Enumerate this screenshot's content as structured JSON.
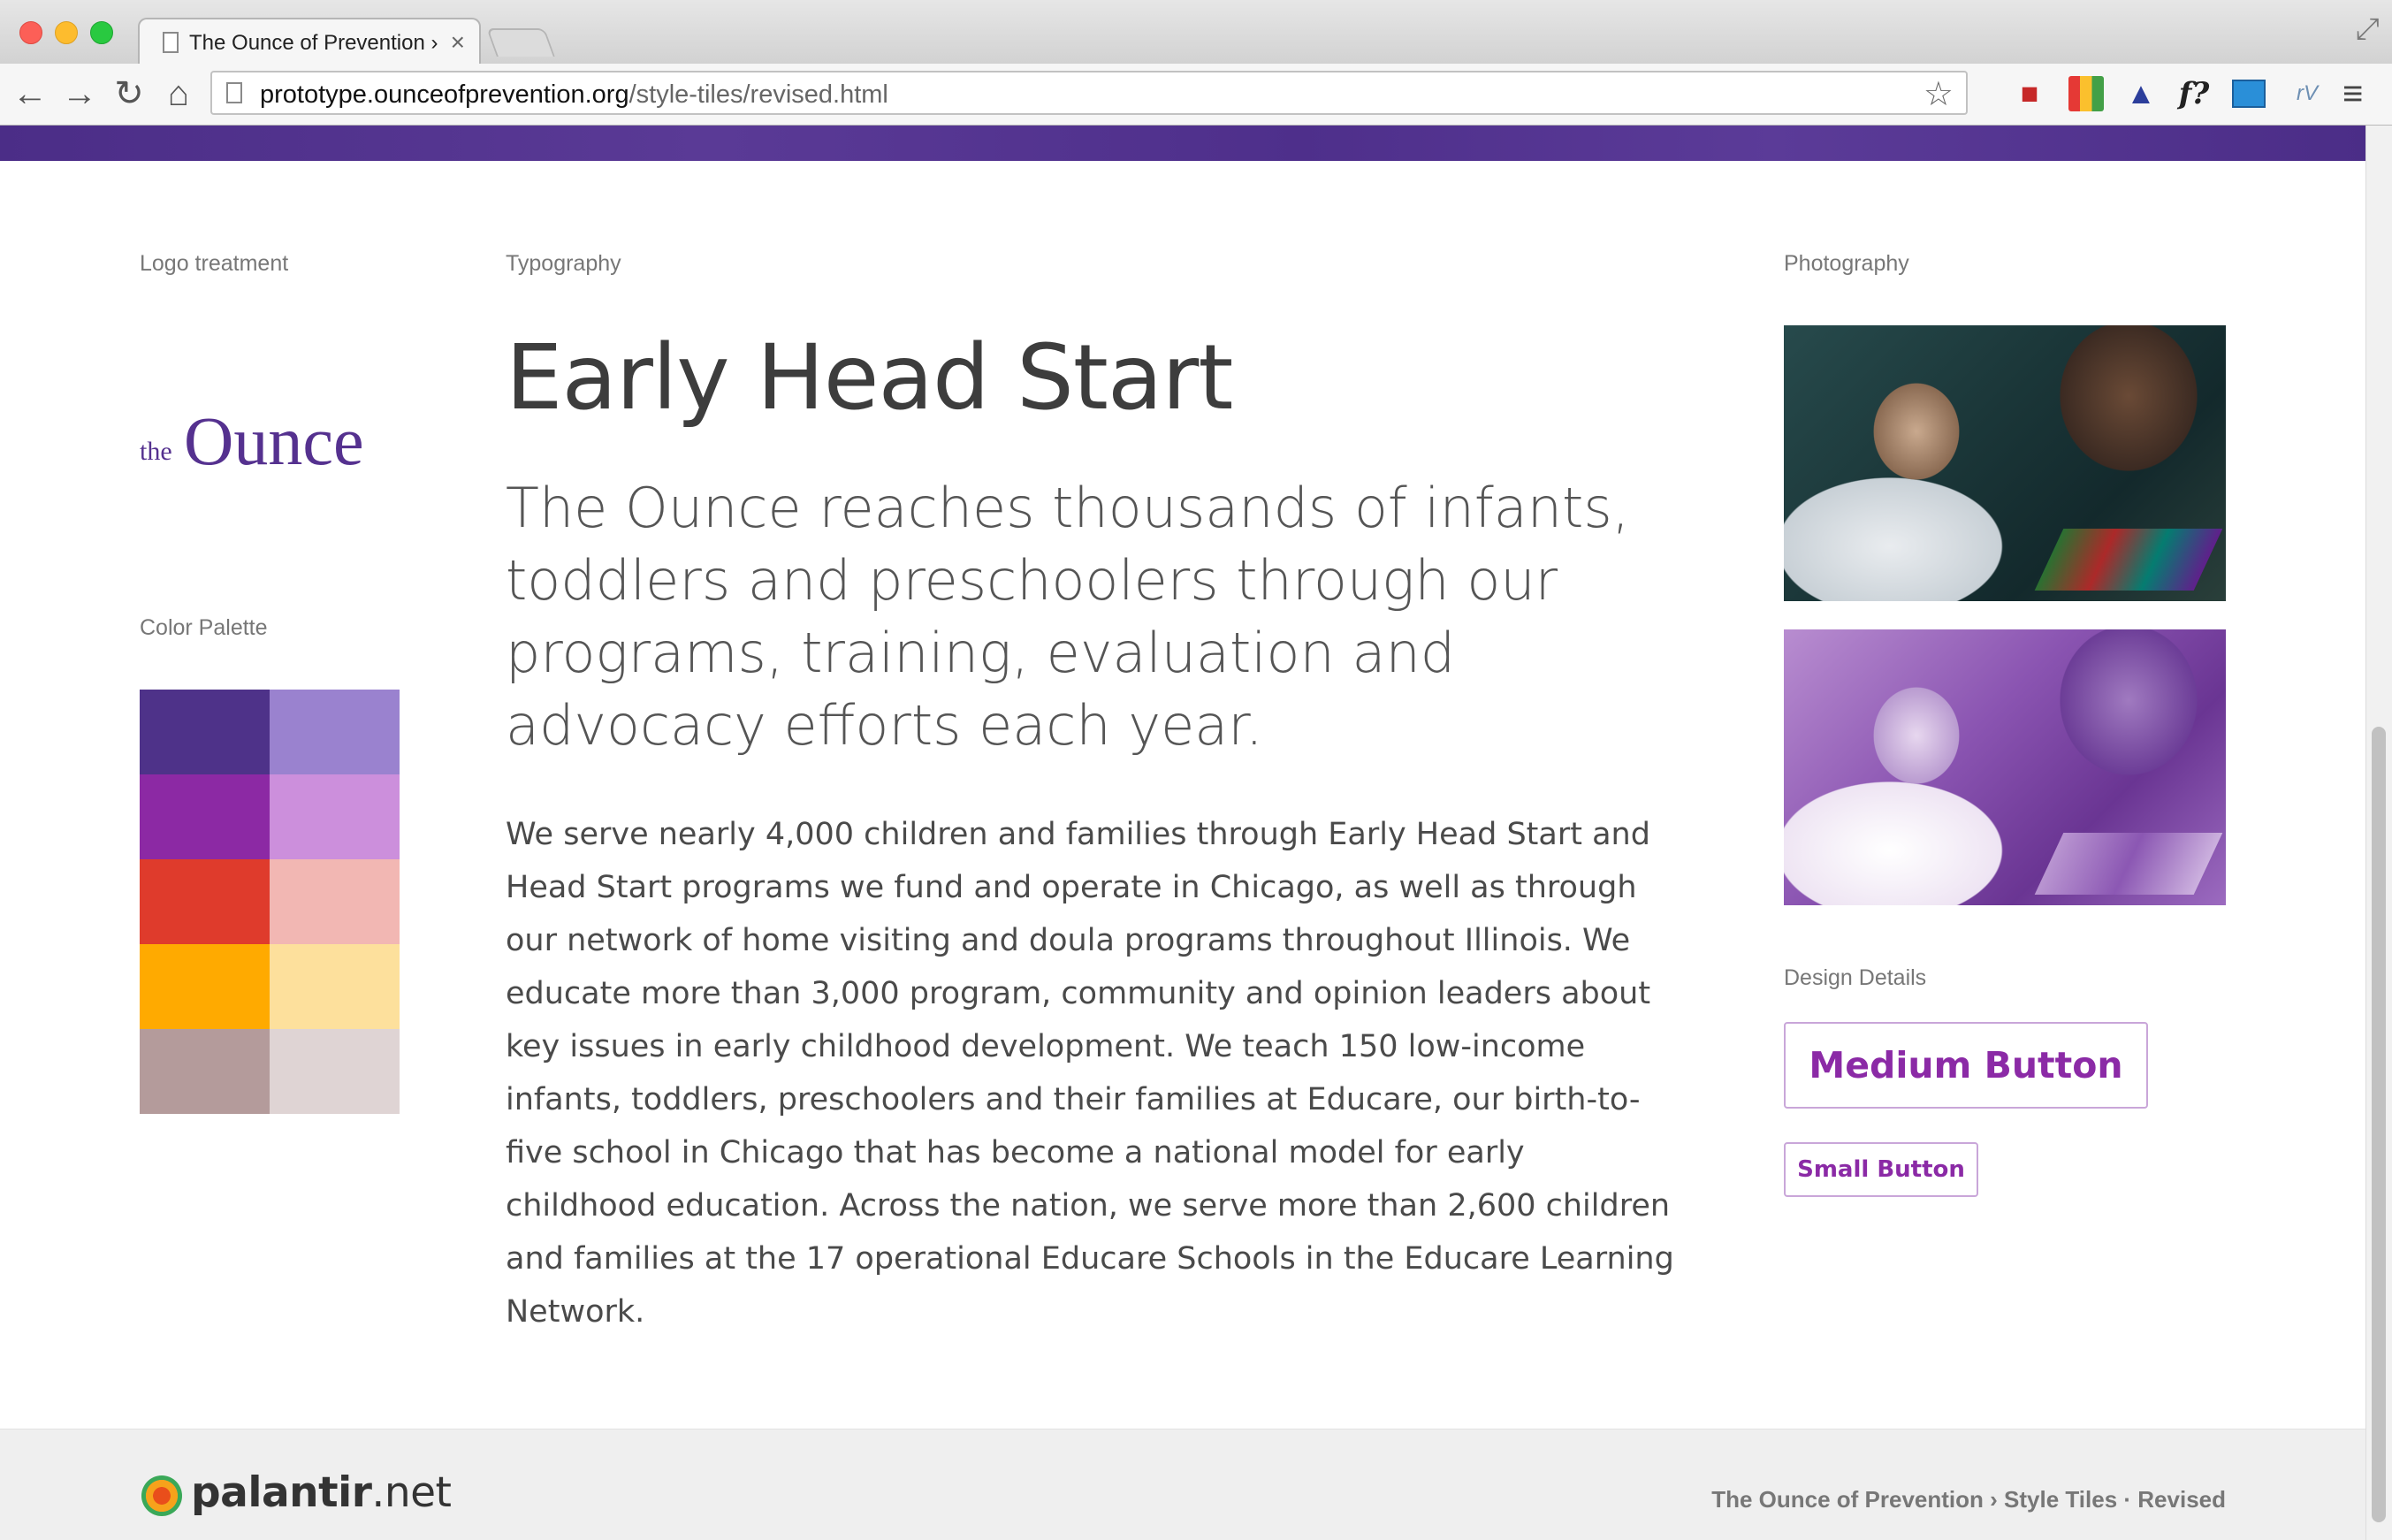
{
  "browser": {
    "tab_title": "The Ounce of Prevention ›",
    "url_domain": "prototype.ounceofprevention.org",
    "url_path": "/style-tiles/revised.html"
  },
  "icons": {
    "back": "←",
    "forward": "→",
    "reload": "↻",
    "home": "⌂",
    "star": "☆",
    "close": "×",
    "resize": "⤢",
    "menu": "≡",
    "font_ext": "f?",
    "rv_ext": "rV"
  },
  "sections": {
    "logo_label": "Logo treatment",
    "typography_label": "Typography",
    "photography_label": "Photography",
    "palette_label": "Color Palette",
    "design_label": "Design Details"
  },
  "logo": {
    "prefix": "the",
    "word": "Ounce"
  },
  "palette": {
    "colors": [
      [
        "#4e3289",
        "#9a82cf"
      ],
      [
        "#8c29a4",
        "#cc8fdc"
      ],
      [
        "#df3b2c",
        "#f2b7b3"
      ],
      [
        "#ffaa00",
        "#fde09c"
      ],
      [
        "#b49b9b",
        "#dfd4d4"
      ]
    ]
  },
  "typography": {
    "headline": "Early Head Start",
    "lead": "The Ounce reaches thousands of infants, toddlers and preschoolers through our programs, training, evaluation and advocacy efforts each year.",
    "body": "We serve nearly 4,000 children and families through Early Head Start and Head Start programs we fund and operate in Chicago, as well as through our network of home visiting and doula programs throughout Illinois. We educate more than 3,000 program, community and opinion leaders about key issues in early childhood development. We teach 150 low-income infants, toddlers, preschoolers and their families at Educare, our birth-to-five school in Chicago that has become a national model for early childhood education. Across the nation, we serve more than 2,600 children and families at the 17 operational Educare Schools in the Educare Learning Network."
  },
  "buttons": {
    "medium": "Medium Button",
    "small": "Small Button"
  },
  "footer": {
    "brand_bold": "palantir",
    "brand_suffix": ".net",
    "crumb": "The Ounce of Prevention › Style Tiles · Revised"
  },
  "colors": {
    "brand_purple": "#55318f",
    "button_purple": "#8b2aa6"
  }
}
